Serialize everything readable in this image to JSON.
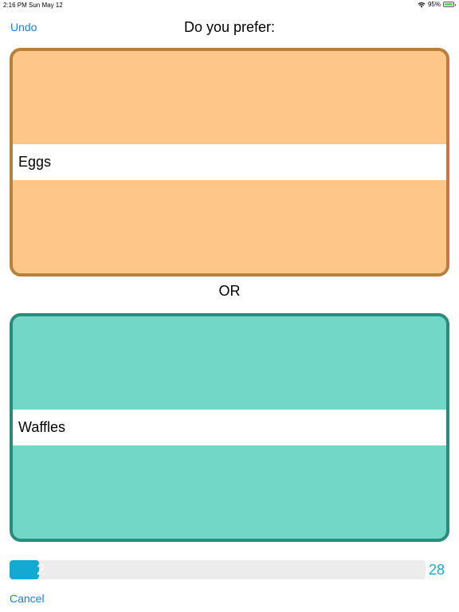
{
  "status_bar": {
    "time": "2:16 PM",
    "date": "Sun May 12",
    "battery": "95%",
    "battery_level": 0.95
  },
  "nav": {
    "undo_label": "Undo",
    "title": "Do you prefer:"
  },
  "choices": [
    {
      "label": "Eggs",
      "fill_color": "#fec789",
      "border_color": "#b8803c"
    },
    {
      "label": "Waffles",
      "fill_color": "#73d7c8",
      "border_color": "#2a8c7c"
    }
  ],
  "separator": "OR",
  "progress": {
    "current": "2",
    "total": "28",
    "fraction": 0.0714,
    "color": "#13a9d3"
  },
  "footer": {
    "cancel_label": "Cancel"
  },
  "colors": {
    "link": "#1a7fe0"
  }
}
